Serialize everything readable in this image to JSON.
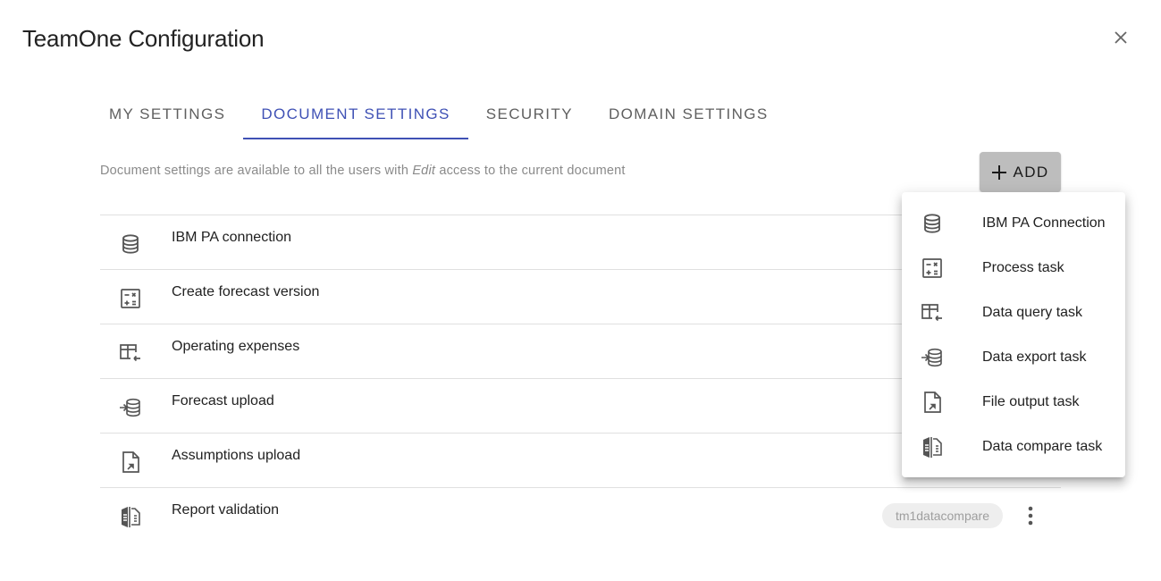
{
  "dialog": {
    "title": "TeamOne Configuration",
    "close_icon": "close-icon"
  },
  "tabs": [
    {
      "label": "MY SETTINGS",
      "active": false
    },
    {
      "label": "DOCUMENT SETTINGS",
      "active": true
    },
    {
      "label": "SECURITY",
      "active": false
    },
    {
      "label": "DOMAIN SETTINGS",
      "active": false
    }
  ],
  "subtitle": {
    "before": "Document settings are available to all the users with ",
    "emphasis": "Edit",
    "after": " access to the current document"
  },
  "add_button": {
    "label": "ADD",
    "icon": "plus-icon"
  },
  "rows": [
    {
      "name": "IBM PA connection",
      "icon": "database-icon"
    },
    {
      "name": "Create forecast version",
      "icon": "calculator-icon"
    },
    {
      "name": "Operating expenses",
      "icon": "table-query-icon"
    },
    {
      "name": "Forecast upload",
      "icon": "database-import-icon"
    },
    {
      "name": "Assumptions upload",
      "icon": "file-output-icon"
    },
    {
      "name": "Report validation",
      "icon": "compare-icon",
      "chip": "tm1datacompare"
    }
  ],
  "menu": {
    "items": [
      {
        "label": "IBM PA Connection",
        "icon": "database-icon"
      },
      {
        "label": "Process task",
        "icon": "calculator-icon"
      },
      {
        "label": "Data query task",
        "icon": "table-query-icon"
      },
      {
        "label": "Data export task",
        "icon": "database-import-icon"
      },
      {
        "label": "File output task",
        "icon": "file-output-icon"
      },
      {
        "label": "Data compare task",
        "icon": "compare-icon"
      }
    ]
  },
  "colors": {
    "accent": "#3f51b5",
    "add_button_bg": "#bdbdbd",
    "chip_bg": "#eeeeee",
    "divider": "#e0e0e0"
  }
}
